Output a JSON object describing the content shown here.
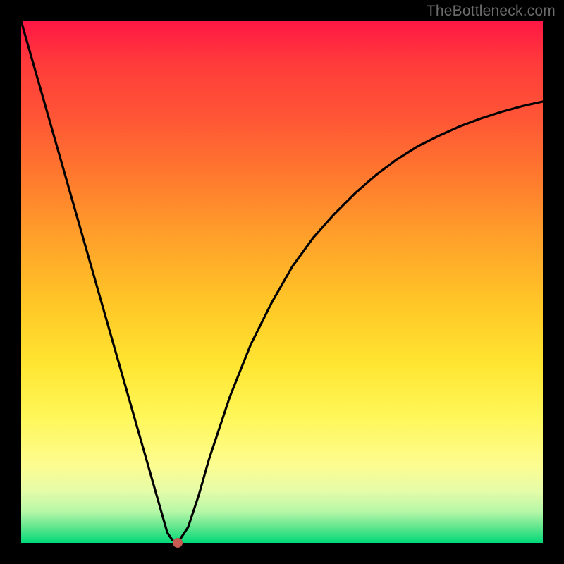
{
  "watermark": "TheBottleneck.com",
  "colors": {
    "background": "#000000",
    "curve": "#000000",
    "marker": "#c75a52",
    "gradient_top": "#ff1744",
    "gradient_bottom": "#00d97a"
  },
  "chart_data": {
    "type": "line",
    "title": "",
    "xlabel": "",
    "ylabel": "",
    "xlim": [
      0,
      100
    ],
    "ylim": [
      0,
      100
    ],
    "grid": false,
    "legend": false,
    "x": [
      0,
      2,
      4,
      6,
      8,
      10,
      12,
      14,
      16,
      18,
      20,
      22,
      24,
      25,
      26,
      27,
      28,
      29,
      30,
      32,
      34,
      36,
      38,
      40,
      44,
      48,
      52,
      56,
      60,
      64,
      68,
      72,
      76,
      80,
      84,
      88,
      92,
      96,
      100
    ],
    "y": [
      100,
      93,
      86,
      79,
      72,
      65,
      58,
      51,
      44,
      37,
      30,
      23,
      16,
      12.5,
      9,
      5.5,
      2,
      0.5,
      0,
      3,
      9,
      16,
      22,
      28,
      38,
      46,
      53,
      58.5,
      63,
      67,
      70.5,
      73.5,
      76,
      78,
      79.8,
      81.3,
      82.6,
      83.7,
      84.6
    ],
    "marker": {
      "x": 30,
      "y": 0
    },
    "annotations": []
  }
}
